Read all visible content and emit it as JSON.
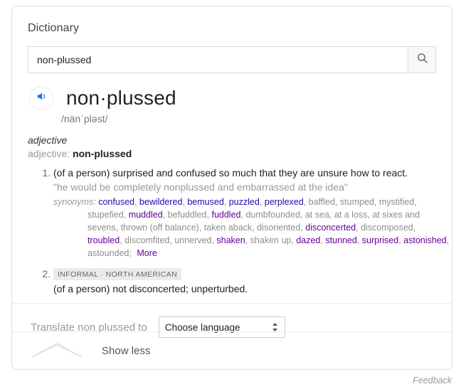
{
  "card": {
    "title": "Dictionary"
  },
  "search": {
    "value": "non-plussed",
    "placeholder": "",
    "icon": "search-icon"
  },
  "entry": {
    "audio_icon": "speaker-icon",
    "headword": "non·plussed",
    "phonetic": "/nänˈpləst/",
    "part_of_speech": "adjective",
    "pos_line_prefix": "adjective:",
    "pos_line_word": "non-plussed"
  },
  "senses": [
    {
      "number": "1.",
      "definition": "(of a person) surprised and confused so much that they are unsure how to react.",
      "example": "\"he would be completely nonplussed and embarrassed at the idea\"",
      "synonyms_label": "synonyms:",
      "synonyms": [
        {
          "text": "confused",
          "style": "link"
        },
        {
          "text": "bewildered",
          "style": "link"
        },
        {
          "text": "bemused",
          "style": "link"
        },
        {
          "text": "puzzled",
          "style": "link"
        },
        {
          "text": "perplexed",
          "style": "link"
        },
        {
          "text": "baffled",
          "style": "plain"
        },
        {
          "text": "stumped",
          "style": "plain"
        },
        {
          "text": "mystified",
          "style": "plain"
        },
        {
          "text": "stupefied",
          "style": "plain"
        },
        {
          "text": "muddled",
          "style": "link"
        },
        {
          "text": "befuddled",
          "style": "plain"
        },
        {
          "text": "fuddled",
          "style": "link"
        },
        {
          "text": "dumbfounded",
          "style": "plain"
        },
        {
          "text": "at sea",
          "style": "plain"
        },
        {
          "text": "at a loss",
          "style": "plain"
        },
        {
          "text": "at sixes and sevens",
          "style": "plain"
        },
        {
          "text": "thrown (off balance)",
          "style": "plain"
        },
        {
          "text": "taken aback",
          "style": "plain"
        },
        {
          "text": "disoriented",
          "style": "plain"
        },
        {
          "text": "disconcerted",
          "style": "link"
        },
        {
          "text": "discomposed",
          "style": "plain"
        },
        {
          "text": "troubled",
          "style": "link"
        },
        {
          "text": "discomfited",
          "style": "plain"
        },
        {
          "text": "unnerved",
          "style": "plain"
        },
        {
          "text": "shaken",
          "style": "link"
        },
        {
          "text": "shaken up",
          "style": "plain"
        },
        {
          "text": "dazed",
          "style": "link"
        },
        {
          "text": "stunned",
          "style": "link"
        },
        {
          "text": "surprised",
          "style": "link"
        },
        {
          "text": "astonished",
          "style": "link"
        },
        {
          "text": "astounded",
          "style": "plain"
        }
      ],
      "more_label": "More"
    },
    {
      "number": "2.",
      "badge": "INFORMAL · NORTH AMERICAN",
      "definition": "(of a person) not disconcerted; unperturbed."
    }
  ],
  "translate": {
    "label": "Translate non plussed to",
    "selected_option": "Choose language",
    "stepper_icon": "stepper-updown-icon"
  },
  "footer": {
    "chevron_icon": "chevron-up-icon",
    "show_less_label": "Show less",
    "feedback_label": "Feedback"
  }
}
